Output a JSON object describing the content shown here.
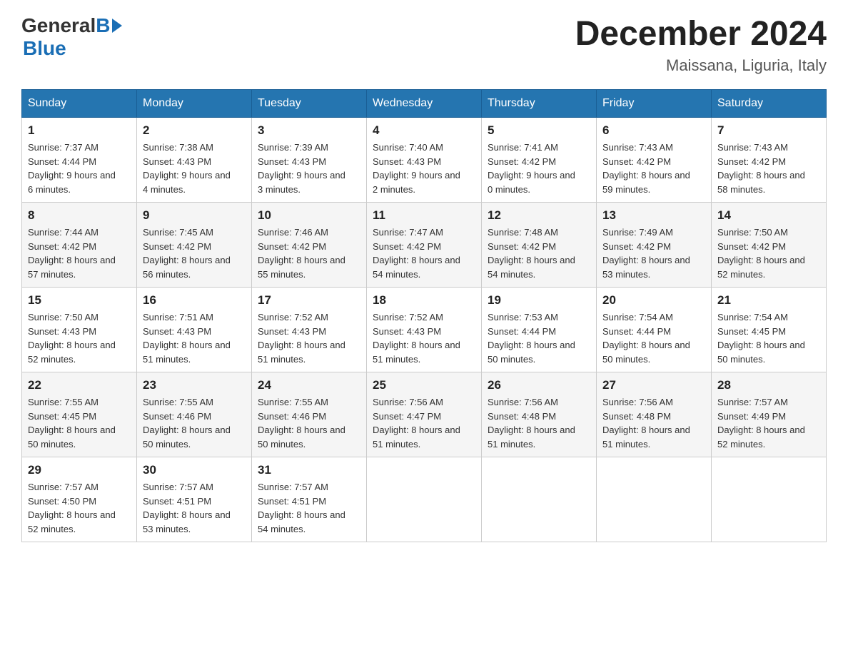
{
  "logo": {
    "general": "General",
    "blue": "Blue"
  },
  "header": {
    "month": "December 2024",
    "location": "Maissana, Liguria, Italy"
  },
  "days_of_week": [
    "Sunday",
    "Monday",
    "Tuesday",
    "Wednesday",
    "Thursday",
    "Friday",
    "Saturday"
  ],
  "weeks": [
    [
      {
        "day": "1",
        "sunrise": "7:37 AM",
        "sunset": "4:44 PM",
        "daylight": "9 hours and 6 minutes."
      },
      {
        "day": "2",
        "sunrise": "7:38 AM",
        "sunset": "4:43 PM",
        "daylight": "9 hours and 4 minutes."
      },
      {
        "day": "3",
        "sunrise": "7:39 AM",
        "sunset": "4:43 PM",
        "daylight": "9 hours and 3 minutes."
      },
      {
        "day": "4",
        "sunrise": "7:40 AM",
        "sunset": "4:43 PM",
        "daylight": "9 hours and 2 minutes."
      },
      {
        "day": "5",
        "sunrise": "7:41 AM",
        "sunset": "4:42 PM",
        "daylight": "9 hours and 0 minutes."
      },
      {
        "day": "6",
        "sunrise": "7:43 AM",
        "sunset": "4:42 PM",
        "daylight": "8 hours and 59 minutes."
      },
      {
        "day": "7",
        "sunrise": "7:43 AM",
        "sunset": "4:42 PM",
        "daylight": "8 hours and 58 minutes."
      }
    ],
    [
      {
        "day": "8",
        "sunrise": "7:44 AM",
        "sunset": "4:42 PM",
        "daylight": "8 hours and 57 minutes."
      },
      {
        "day": "9",
        "sunrise": "7:45 AM",
        "sunset": "4:42 PM",
        "daylight": "8 hours and 56 minutes."
      },
      {
        "day": "10",
        "sunrise": "7:46 AM",
        "sunset": "4:42 PM",
        "daylight": "8 hours and 55 minutes."
      },
      {
        "day": "11",
        "sunrise": "7:47 AM",
        "sunset": "4:42 PM",
        "daylight": "8 hours and 54 minutes."
      },
      {
        "day": "12",
        "sunrise": "7:48 AM",
        "sunset": "4:42 PM",
        "daylight": "8 hours and 54 minutes."
      },
      {
        "day": "13",
        "sunrise": "7:49 AM",
        "sunset": "4:42 PM",
        "daylight": "8 hours and 53 minutes."
      },
      {
        "day": "14",
        "sunrise": "7:50 AM",
        "sunset": "4:42 PM",
        "daylight": "8 hours and 52 minutes."
      }
    ],
    [
      {
        "day": "15",
        "sunrise": "7:50 AM",
        "sunset": "4:43 PM",
        "daylight": "8 hours and 52 minutes."
      },
      {
        "day": "16",
        "sunrise": "7:51 AM",
        "sunset": "4:43 PM",
        "daylight": "8 hours and 51 minutes."
      },
      {
        "day": "17",
        "sunrise": "7:52 AM",
        "sunset": "4:43 PM",
        "daylight": "8 hours and 51 minutes."
      },
      {
        "day": "18",
        "sunrise": "7:52 AM",
        "sunset": "4:43 PM",
        "daylight": "8 hours and 51 minutes."
      },
      {
        "day": "19",
        "sunrise": "7:53 AM",
        "sunset": "4:44 PM",
        "daylight": "8 hours and 50 minutes."
      },
      {
        "day": "20",
        "sunrise": "7:54 AM",
        "sunset": "4:44 PM",
        "daylight": "8 hours and 50 minutes."
      },
      {
        "day": "21",
        "sunrise": "7:54 AM",
        "sunset": "4:45 PM",
        "daylight": "8 hours and 50 minutes."
      }
    ],
    [
      {
        "day": "22",
        "sunrise": "7:55 AM",
        "sunset": "4:45 PM",
        "daylight": "8 hours and 50 minutes."
      },
      {
        "day": "23",
        "sunrise": "7:55 AM",
        "sunset": "4:46 PM",
        "daylight": "8 hours and 50 minutes."
      },
      {
        "day": "24",
        "sunrise": "7:55 AM",
        "sunset": "4:46 PM",
        "daylight": "8 hours and 50 minutes."
      },
      {
        "day": "25",
        "sunrise": "7:56 AM",
        "sunset": "4:47 PM",
        "daylight": "8 hours and 51 minutes."
      },
      {
        "day": "26",
        "sunrise": "7:56 AM",
        "sunset": "4:48 PM",
        "daylight": "8 hours and 51 minutes."
      },
      {
        "day": "27",
        "sunrise": "7:56 AM",
        "sunset": "4:48 PM",
        "daylight": "8 hours and 51 minutes."
      },
      {
        "day": "28",
        "sunrise": "7:57 AM",
        "sunset": "4:49 PM",
        "daylight": "8 hours and 52 minutes."
      }
    ],
    [
      {
        "day": "29",
        "sunrise": "7:57 AM",
        "sunset": "4:50 PM",
        "daylight": "8 hours and 52 minutes."
      },
      {
        "day": "30",
        "sunrise": "7:57 AM",
        "sunset": "4:51 PM",
        "daylight": "8 hours and 53 minutes."
      },
      {
        "day": "31",
        "sunrise": "7:57 AM",
        "sunset": "4:51 PM",
        "daylight": "8 hours and 54 minutes."
      },
      null,
      null,
      null,
      null
    ]
  ]
}
